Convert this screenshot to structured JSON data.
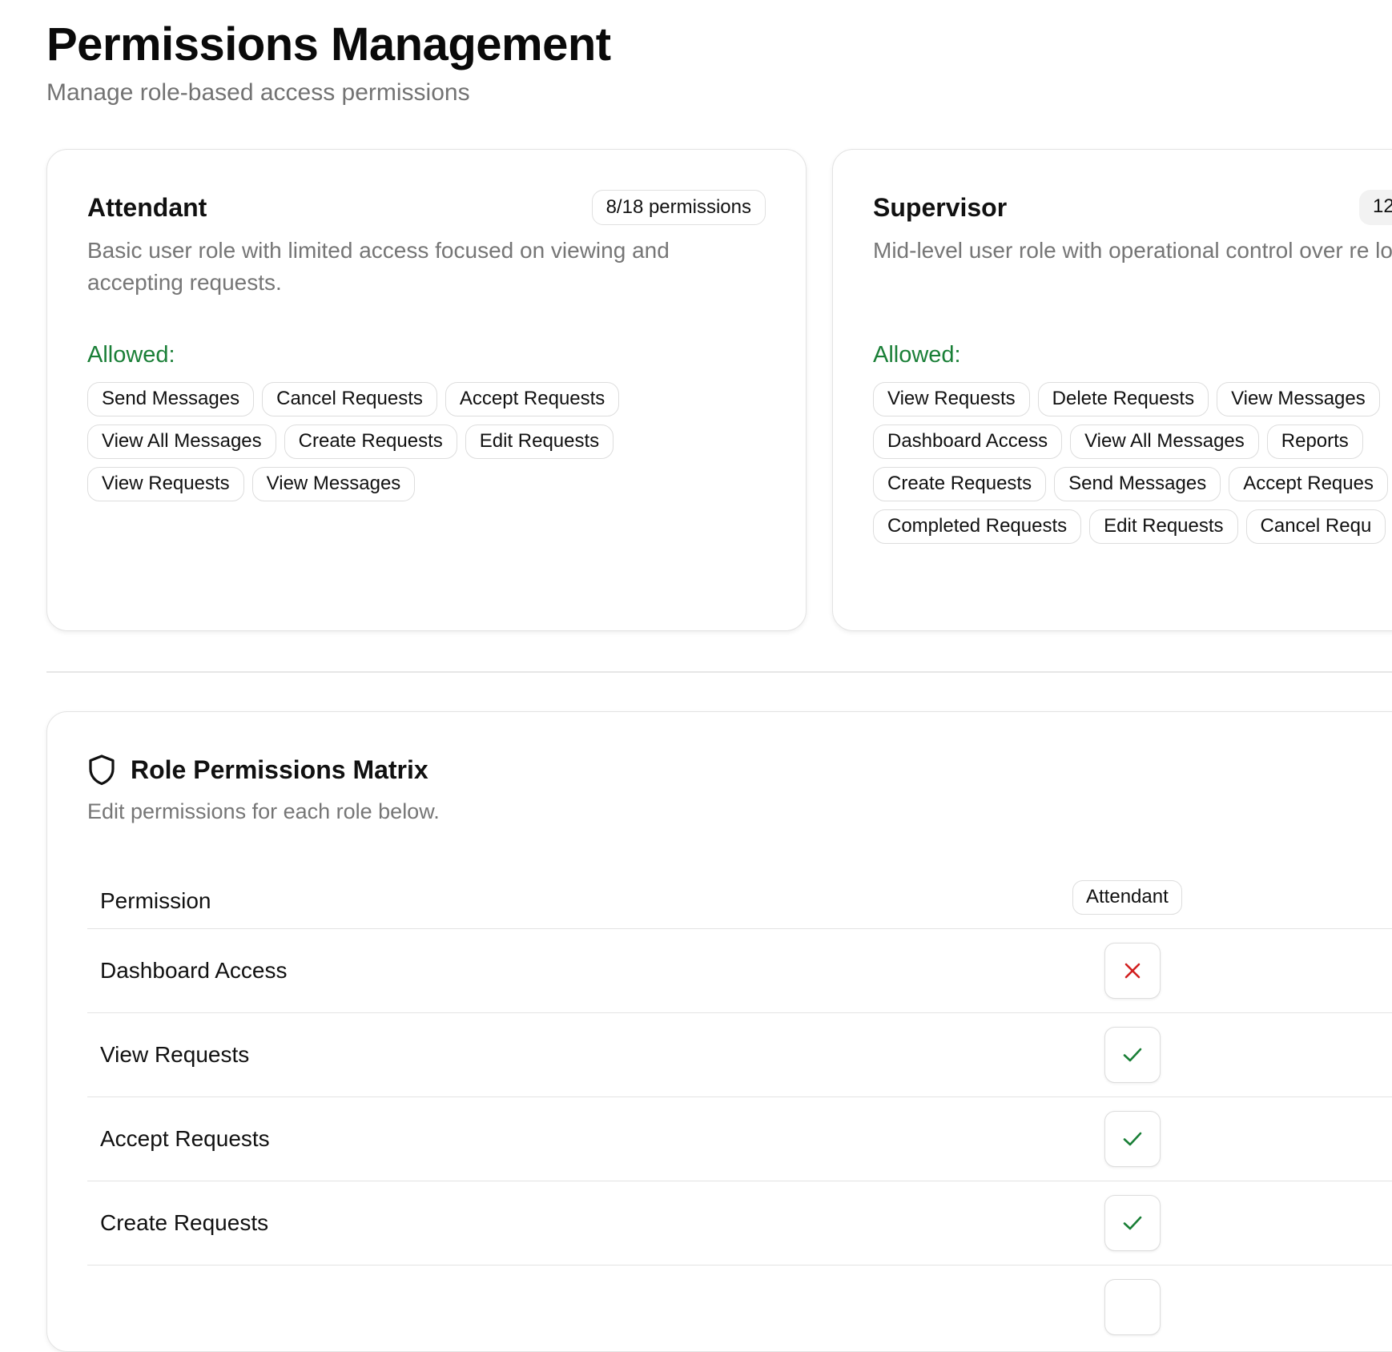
{
  "page": {
    "title": "Permissions Management",
    "subtitle": "Manage role-based access permissions"
  },
  "roles": [
    {
      "name": "Attendant",
      "count_label": "8/18 permissions",
      "description": "Basic user role with limited access focused on viewing and accepting requests.",
      "allowed_label": "Allowed:",
      "allowed": [
        "Send Messages",
        "Cancel Requests",
        "Accept Requests",
        "View All Messages",
        "Create Requests",
        "Edit Requests",
        "View Requests",
        "View Messages"
      ]
    },
    {
      "name": "Supervisor",
      "count_label": "12",
      "description": "Mid-level user role with operational control over re locations.",
      "allowed_label": "Allowed:",
      "allowed": [
        "View Requests",
        "Delete Requests",
        "View Messages",
        "Dashboard Access",
        "View All Messages",
        "Reports",
        "Create Requests",
        "Send Messages",
        "Accept Reques",
        "Completed Requests",
        "Edit Requests",
        "Cancel Requ"
      ]
    }
  ],
  "matrix": {
    "icon": "shield-icon",
    "title": "Role Permissions Matrix",
    "subtitle": "Edit permissions for each role below.",
    "permission_header": "Permission",
    "role_columns": [
      "Attendant"
    ],
    "rows": [
      {
        "permission": "Dashboard Access",
        "attendant": false
      },
      {
        "permission": "View Requests",
        "attendant": true
      },
      {
        "permission": "Accept Requests",
        "attendant": true
      },
      {
        "permission": "Create Requests",
        "attendant": true
      }
    ]
  },
  "colors": {
    "allowed_green": "#1a7f37",
    "check_green": "#1a7f37",
    "deny_red": "#d21f1f",
    "muted_text": "#767676",
    "border": "#e3e3e3"
  }
}
